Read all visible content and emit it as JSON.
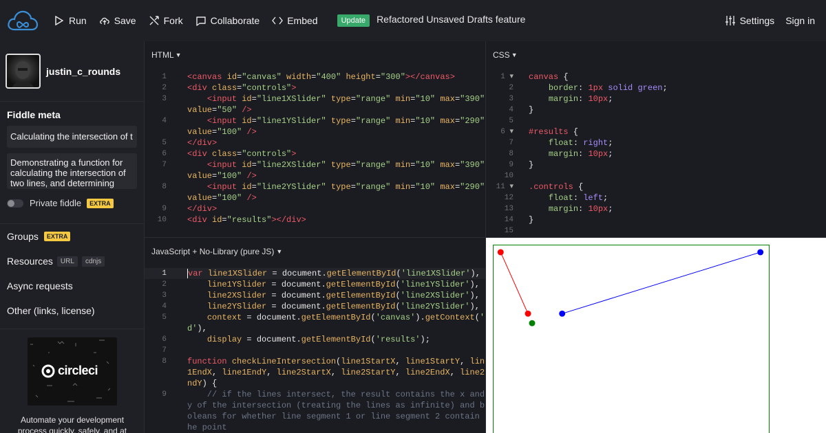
{
  "topbar": {
    "run": "Run",
    "save": "Save",
    "fork": "Fork",
    "collaborate": "Collaborate",
    "embed": "Embed",
    "update_badge": "Update",
    "update_text": "Refactored Unsaved Drafts feature",
    "settings": "Settings",
    "sign_in": "Sign in"
  },
  "sidebar": {
    "username": "justin_c_rounds",
    "meta_title": "Fiddle meta",
    "title_value": "Calculating the intersection of t",
    "description_value": "Demonstrating a function for calculating the intersection of two lines, and determining",
    "private_label": "Private fiddle",
    "extra": "EXTRA",
    "groups": "Groups",
    "groups_extra": "EXTRA",
    "resources": "Resources",
    "resources_tags": [
      "URL",
      "cdnjs"
    ],
    "async": "Async requests",
    "other": "Other (links, license)",
    "ad_brand": "circleci",
    "ad_text": "Automate your development process quickly, safely, and at"
  },
  "panels": {
    "html_title": "HTML",
    "css_title": "CSS",
    "js_title": "JavaScript + No-Library (pure JS)"
  },
  "colors": {
    "accent": "#39a96b",
    "extra": "#f5c842",
    "line1": "#ff0000",
    "line2": "#0000ff",
    "intersection": "#008000"
  }
}
